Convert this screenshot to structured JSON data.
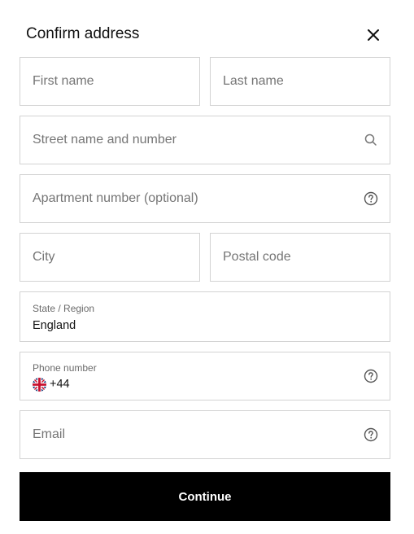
{
  "dialog": {
    "title": "Confirm address",
    "close_icon": "close-icon"
  },
  "form": {
    "first_name": {
      "placeholder": "First name"
    },
    "last_name": {
      "placeholder": "Last name"
    },
    "street": {
      "placeholder": "Street name and number",
      "icon": "search-icon"
    },
    "apartment": {
      "placeholder": "Apartment number (optional)",
      "icon": "help-circle-icon"
    },
    "city": {
      "placeholder": "City"
    },
    "postal_code": {
      "placeholder": "Postal code"
    },
    "state": {
      "label": "State / Region",
      "value": "England"
    },
    "phone": {
      "label": "Phone number",
      "flag_icon": "uk-flag-icon",
      "country_code": "+44",
      "icon": "help-circle-icon"
    },
    "email": {
      "placeholder": "Email",
      "icon": "help-circle-icon"
    }
  },
  "actions": {
    "continue_label": "Continue"
  },
  "colors": {
    "border": "#d3d3d3",
    "placeholder": "#757575",
    "button_bg": "#000000",
    "button_text": "#ffffff"
  }
}
